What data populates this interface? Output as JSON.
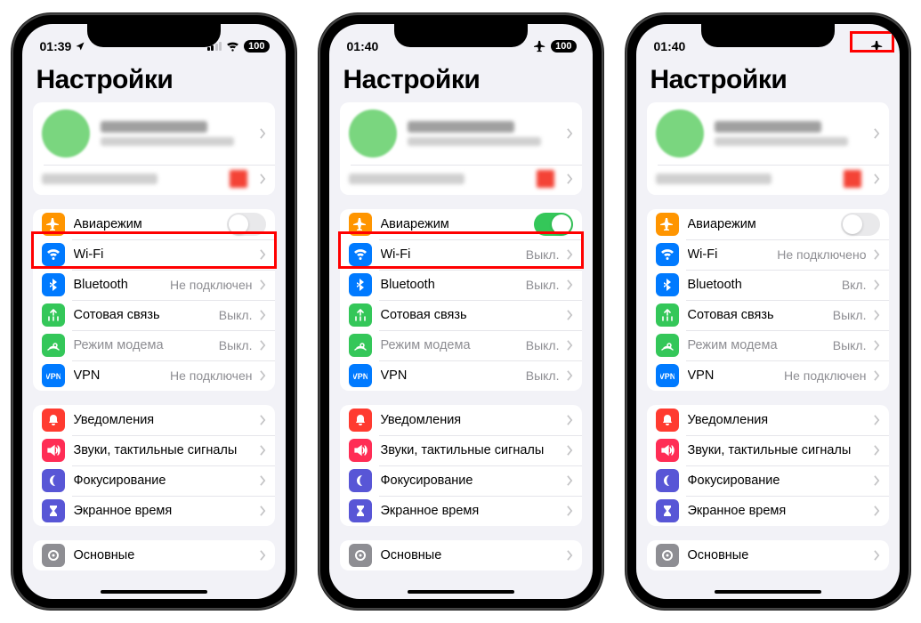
{
  "phones": [
    {
      "time": "01:39",
      "show_location": true,
      "show_wifi_status": true,
      "show_signal_weak": true,
      "show_airplane_status": false,
      "battery": "100",
      "title": "Настройки",
      "airplane_on": false,
      "highlight_airplane": true,
      "highlight_status": false,
      "rows1": [
        {
          "icon": "airplane",
          "color": "ic-orange",
          "label": "Авиарежим",
          "type": "toggle"
        },
        {
          "icon": "wifi",
          "color": "ic-blue",
          "label": "Wi-Fi",
          "value": "",
          "type": "link"
        },
        {
          "icon": "bluetooth",
          "color": "ic-blue",
          "label": "Bluetooth",
          "value": "Не подключен",
          "type": "link"
        },
        {
          "icon": "cellular",
          "color": "ic-green",
          "label": "Сотовая связь",
          "value": "Выкл.",
          "type": "link"
        },
        {
          "icon": "hotspot",
          "color": "ic-green2",
          "label": "Режим модема",
          "value": "Выкл.",
          "type": "link",
          "disabled": true
        },
        {
          "icon": "vpn",
          "color": "ic-vpn",
          "label": "VPN",
          "value": "Не подключен",
          "type": "link"
        }
      ],
      "rows2": [
        {
          "icon": "bell",
          "color": "ic-red",
          "label": "Уведомления",
          "type": "link"
        },
        {
          "icon": "speaker",
          "color": "ic-pink",
          "label": "Звуки, тактильные сигналы",
          "type": "link"
        },
        {
          "icon": "moon",
          "color": "ic-purple",
          "label": "Фокусирование",
          "type": "link"
        },
        {
          "icon": "hourglass",
          "color": "ic-purple",
          "label": "Экранное время",
          "type": "link"
        }
      ],
      "rows3": [
        {
          "icon": "gear",
          "color": "ic-gray",
          "label": "Основные",
          "type": "link"
        }
      ]
    },
    {
      "time": "01:40",
      "show_location": false,
      "show_wifi_status": false,
      "show_signal_weak": false,
      "show_airplane_status": true,
      "battery": "100",
      "title": "Настройки",
      "airplane_on": true,
      "highlight_airplane": true,
      "highlight_status": false,
      "rows1": [
        {
          "icon": "airplane",
          "color": "ic-orange",
          "label": "Авиарежим",
          "type": "toggle"
        },
        {
          "icon": "wifi",
          "color": "ic-blue",
          "label": "Wi-Fi",
          "value": "Выкл.",
          "type": "link"
        },
        {
          "icon": "bluetooth",
          "color": "ic-blue",
          "label": "Bluetooth",
          "value": "Выкл.",
          "type": "link"
        },
        {
          "icon": "cellular",
          "color": "ic-green",
          "label": "Сотовая связь",
          "value": "",
          "type": "link"
        },
        {
          "icon": "hotspot",
          "color": "ic-green2",
          "label": "Режим модема",
          "value": "Выкл.",
          "type": "link",
          "disabled": true
        },
        {
          "icon": "vpn",
          "color": "ic-vpn",
          "label": "VPN",
          "value": "Выкл.",
          "type": "link"
        }
      ],
      "rows2": [
        {
          "icon": "bell",
          "color": "ic-red",
          "label": "Уведомления",
          "type": "link"
        },
        {
          "icon": "speaker",
          "color": "ic-pink",
          "label": "Звуки, тактильные сигналы",
          "type": "link"
        },
        {
          "icon": "moon",
          "color": "ic-purple",
          "label": "Фокусирование",
          "type": "link"
        },
        {
          "icon": "hourglass",
          "color": "ic-purple",
          "label": "Экранное время",
          "type": "link"
        }
      ],
      "rows3": [
        {
          "icon": "gear",
          "color": "ic-gray",
          "label": "Основные",
          "type": "link"
        }
      ]
    },
    {
      "time": "01:40",
      "show_location": false,
      "show_wifi_status": false,
      "show_signal_weak": false,
      "show_airplane_status": true,
      "battery": "",
      "title": "Настройки",
      "airplane_on": false,
      "highlight_airplane": false,
      "highlight_status": true,
      "rows1": [
        {
          "icon": "airplane",
          "color": "ic-orange",
          "label": "Авиарежим",
          "type": "toggle"
        },
        {
          "icon": "wifi",
          "color": "ic-blue",
          "label": "Wi-Fi",
          "value": "Не подключено",
          "type": "link"
        },
        {
          "icon": "bluetooth",
          "color": "ic-blue",
          "label": "Bluetooth",
          "value": "Вкл.",
          "type": "link"
        },
        {
          "icon": "cellular",
          "color": "ic-green",
          "label": "Сотовая связь",
          "value": "Выкл.",
          "type": "link"
        },
        {
          "icon": "hotspot",
          "color": "ic-green2",
          "label": "Режим модема",
          "value": "Выкл.",
          "type": "link",
          "disabled": true
        },
        {
          "icon": "vpn",
          "color": "ic-vpn",
          "label": "VPN",
          "value": "Не подключен",
          "type": "link"
        }
      ],
      "rows2": [
        {
          "icon": "bell",
          "color": "ic-red",
          "label": "Уведомления",
          "type": "link"
        },
        {
          "icon": "speaker",
          "color": "ic-pink",
          "label": "Звуки, тактильные сигналы",
          "type": "link"
        },
        {
          "icon": "moon",
          "color": "ic-purple",
          "label": "Фокусирование",
          "type": "link"
        },
        {
          "icon": "hourglass",
          "color": "ic-purple",
          "label": "Экранное время",
          "type": "link"
        }
      ],
      "rows3": [
        {
          "icon": "gear",
          "color": "ic-gray",
          "label": "Основные",
          "type": "link"
        }
      ]
    }
  ],
  "icons_svg": {
    "airplane": "<path d='M8 1l1 5 5 2v1l-5 0-1 4 2 1v1H4v-1l2-1-1-4-5 0V8l5-2 1-5z' fill='white'/>",
    "wifi": "<path d='M1 5a10 10 0 0114 0l-2 2a7 7 0 00-10 0zM4 8a6 6 0 018 0l-2 2a3 3 0 00-4 0zM8 11a1.5 1.5 0 110 3 1.5 1.5 0 010-3z' fill='white'/>",
    "bluetooth": "<path d='M7 1l5 4-4 3 4 3-5 4V9L4 11V9l3-1-3-1V5l3 2z' fill='white'/>",
    "cellular": "<path d='M8 2l3 3M8 2l-3 3M8 2v6M3 14v-4M8 14v-4M13 14v-4' stroke='white' stroke-width='1.6' fill='none' stroke-linecap='round'/>",
    "hotspot": "<path d='M8 8a2 2 0 110 .01zM4 11a6 6 0 018 0M2 13a9 9 0 0112 0' stroke='white' stroke-width='1.5' fill='none' stroke-linecap='round'/>",
    "vpn": "<text x='8' y='12' font-size='9' font-weight='700' text-anchor='middle' fill='white' font-family='Arial'>VPN</text>",
    "bell": "<path d='M8 2a4 4 0 014 4v3l1 2H3l1-2V6a4 4 0 014-4zM6 12a2 2 0 004 0z' fill='white'/>",
    "speaker": "<path d='M2 6h3l4-3v10l-4-3H2zM11 5a4 4 0 010 6M13 3a7 7 0 010 10' stroke='white' stroke-width='1.3' fill='white' stroke-linecap='round'/>",
    "moon": "<path d='M10 2a6 6 0 100 12A8 8 0 0110 2z' fill='white'/>",
    "hourglass": "<path d='M4 2h8v2l-3 4 3 4v2H4v-2l3-4-3-4z' fill='white'/>",
    "gear": "<circle cx='8' cy='8' r='5' fill='none' stroke='white' stroke-width='2'/><circle cx='8' cy='8' r='1.5' fill='white'/>"
  }
}
